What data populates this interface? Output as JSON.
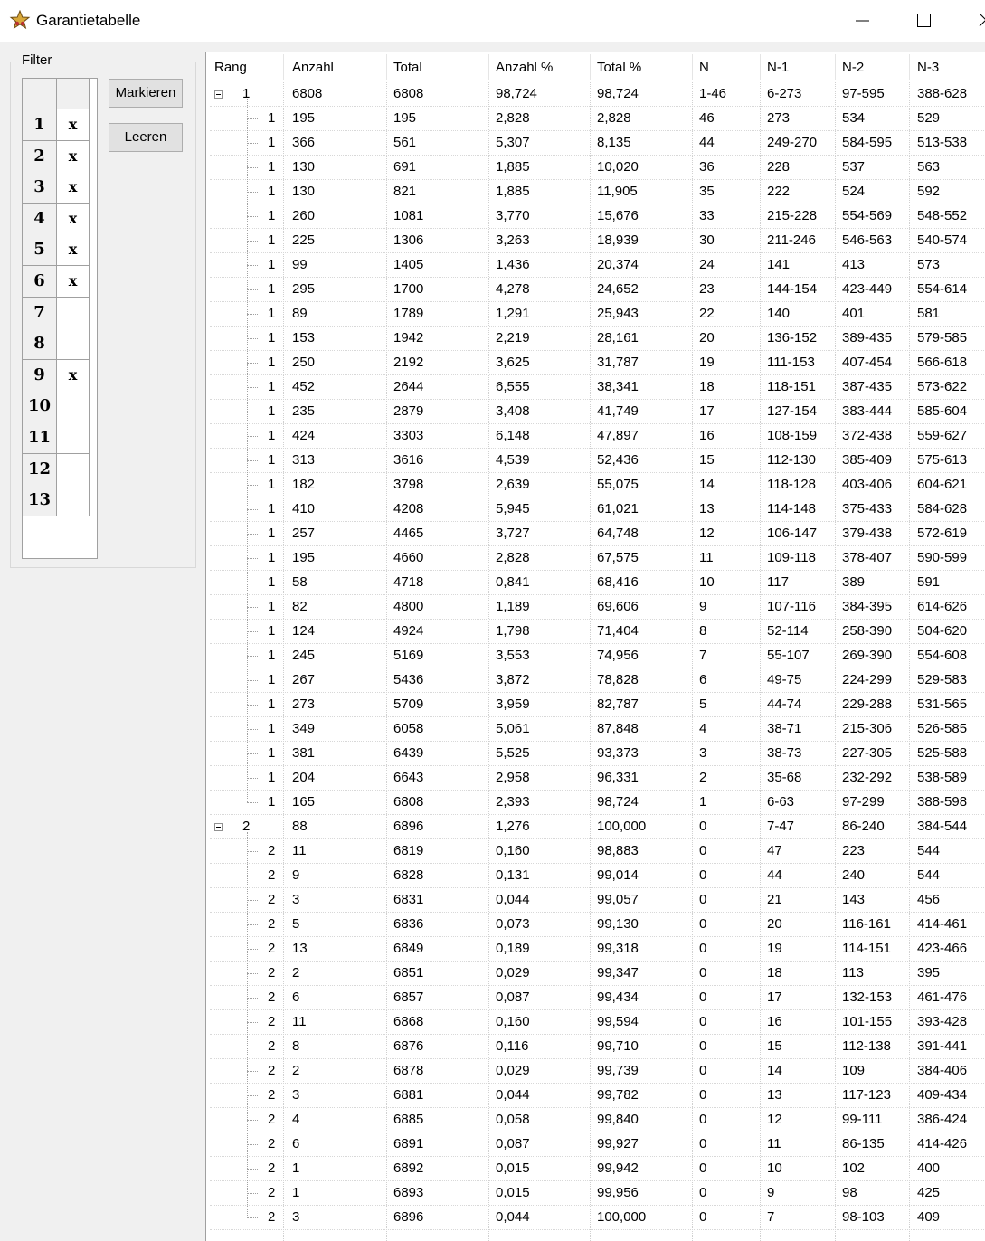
{
  "window": {
    "title": "Garantietabelle"
  },
  "filter": {
    "label": "Filter",
    "rows": [
      {
        "num": "1",
        "val": "x"
      },
      {
        "num": "2",
        "val": "x"
      },
      {
        "num": "3",
        "val": "x"
      },
      {
        "num": "4",
        "val": "x"
      },
      {
        "num": "5",
        "val": "x"
      },
      {
        "num": "6",
        "val": "x"
      },
      {
        "num": "7",
        "val": ""
      },
      {
        "num": "8",
        "val": ""
      },
      {
        "num": "9",
        "val": "x"
      },
      {
        "num": "10",
        "val": ""
      },
      {
        "num": "11",
        "val": ""
      },
      {
        "num": "12",
        "val": ""
      },
      {
        "num": "13",
        "val": ""
      }
    ],
    "mark_button": "Markieren",
    "clear_button": "Leeren"
  },
  "table": {
    "columns": [
      "Rang",
      "Anzahl",
      "Total",
      "Anzahl %",
      "Total %",
      "N",
      "N-1",
      "N-2",
      "N-3"
    ],
    "rows": [
      {
        "level": 0,
        "cells": [
          "1",
          "6808",
          "6808",
          "98,724",
          "98,724",
          "1-46",
          "6-273",
          "97-595",
          "388-628"
        ]
      },
      {
        "level": 1,
        "cells": [
          "1",
          "195",
          "195",
          "2,828",
          "2,828",
          "46",
          "273",
          "534",
          "529"
        ]
      },
      {
        "level": 1,
        "cells": [
          "1",
          "366",
          "561",
          "5,307",
          "8,135",
          "44",
          "249-270",
          "584-595",
          "513-538"
        ]
      },
      {
        "level": 1,
        "cells": [
          "1",
          "130",
          "691",
          "1,885",
          "10,020",
          "36",
          "228",
          "537",
          "563"
        ]
      },
      {
        "level": 1,
        "cells": [
          "1",
          "130",
          "821",
          "1,885",
          "11,905",
          "35",
          "222",
          "524",
          "592"
        ]
      },
      {
        "level": 1,
        "cells": [
          "1",
          "260",
          "1081",
          "3,770",
          "15,676",
          "33",
          "215-228",
          "554-569",
          "548-552"
        ]
      },
      {
        "level": 1,
        "cells": [
          "1",
          "225",
          "1306",
          "3,263",
          "18,939",
          "30",
          "211-246",
          "546-563",
          "540-574"
        ]
      },
      {
        "level": 1,
        "cells": [
          "1",
          "99",
          "1405",
          "1,436",
          "20,374",
          "24",
          "141",
          "413",
          "573"
        ]
      },
      {
        "level": 1,
        "cells": [
          "1",
          "295",
          "1700",
          "4,278",
          "24,652",
          "23",
          "144-154",
          "423-449",
          "554-614"
        ]
      },
      {
        "level": 1,
        "cells": [
          "1",
          "89",
          "1789",
          "1,291",
          "25,943",
          "22",
          "140",
          "401",
          "581"
        ]
      },
      {
        "level": 1,
        "cells": [
          "1",
          "153",
          "1942",
          "2,219",
          "28,161",
          "20",
          "136-152",
          "389-435",
          "579-585"
        ]
      },
      {
        "level": 1,
        "cells": [
          "1",
          "250",
          "2192",
          "3,625",
          "31,787",
          "19",
          "111-153",
          "407-454",
          "566-618"
        ]
      },
      {
        "level": 1,
        "cells": [
          "1",
          "452",
          "2644",
          "6,555",
          "38,341",
          "18",
          "118-151",
          "387-435",
          "573-622"
        ]
      },
      {
        "level": 1,
        "cells": [
          "1",
          "235",
          "2879",
          "3,408",
          "41,749",
          "17",
          "127-154",
          "383-444",
          "585-604"
        ]
      },
      {
        "level": 1,
        "cells": [
          "1",
          "424",
          "3303",
          "6,148",
          "47,897",
          "16",
          "108-159",
          "372-438",
          "559-627"
        ]
      },
      {
        "level": 1,
        "cells": [
          "1",
          "313",
          "3616",
          "4,539",
          "52,436",
          "15",
          "112-130",
          "385-409",
          "575-613"
        ]
      },
      {
        "level": 1,
        "cells": [
          "1",
          "182",
          "3798",
          "2,639",
          "55,075",
          "14",
          "118-128",
          "403-406",
          "604-621"
        ]
      },
      {
        "level": 1,
        "cells": [
          "1",
          "410",
          "4208",
          "5,945",
          "61,021",
          "13",
          "114-148",
          "375-433",
          "584-628"
        ]
      },
      {
        "level": 1,
        "cells": [
          "1",
          "257",
          "4465",
          "3,727",
          "64,748",
          "12",
          "106-147",
          "379-438",
          "572-619"
        ]
      },
      {
        "level": 1,
        "cells": [
          "1",
          "195",
          "4660",
          "2,828",
          "67,575",
          "11",
          "109-118",
          "378-407",
          "590-599"
        ]
      },
      {
        "level": 1,
        "cells": [
          "1",
          "58",
          "4718",
          "0,841",
          "68,416",
          "10",
          "117",
          "389",
          "591"
        ]
      },
      {
        "level": 1,
        "cells": [
          "1",
          "82",
          "4800",
          "1,189",
          "69,606",
          "9",
          "107-116",
          "384-395",
          "614-626"
        ]
      },
      {
        "level": 1,
        "cells": [
          "1",
          "124",
          "4924",
          "1,798",
          "71,404",
          "8",
          "52-114",
          "258-390",
          "504-620"
        ]
      },
      {
        "level": 1,
        "cells": [
          "1",
          "245",
          "5169",
          "3,553",
          "74,956",
          "7",
          "55-107",
          "269-390",
          "554-608"
        ]
      },
      {
        "level": 1,
        "cells": [
          "1",
          "267",
          "5436",
          "3,872",
          "78,828",
          "6",
          "49-75",
          "224-299",
          "529-583"
        ]
      },
      {
        "level": 1,
        "cells": [
          "1",
          "273",
          "5709",
          "3,959",
          "82,787",
          "5",
          "44-74",
          "229-288",
          "531-565"
        ]
      },
      {
        "level": 1,
        "cells": [
          "1",
          "349",
          "6058",
          "5,061",
          "87,848",
          "4",
          "38-71",
          "215-306",
          "526-585"
        ]
      },
      {
        "level": 1,
        "cells": [
          "1",
          "381",
          "6439",
          "5,525",
          "93,373",
          "3",
          "38-73",
          "227-305",
          "525-588"
        ]
      },
      {
        "level": 1,
        "cells": [
          "1",
          "204",
          "6643",
          "2,958",
          "96,331",
          "2",
          "35-68",
          "232-292",
          "538-589"
        ]
      },
      {
        "level": 1,
        "cells": [
          "1",
          "165",
          "6808",
          "2,393",
          "98,724",
          "1",
          "6-63",
          "97-299",
          "388-598"
        ]
      },
      {
        "level": 0,
        "cells": [
          "2",
          "88",
          "6896",
          "1,276",
          "100,000",
          "0",
          "7-47",
          "86-240",
          "384-544"
        ]
      },
      {
        "level": 1,
        "cells": [
          "2",
          "11",
          "6819",
          "0,160",
          "98,883",
          "0",
          "47",
          "223",
          "544"
        ]
      },
      {
        "level": 1,
        "cells": [
          "2",
          "9",
          "6828",
          "0,131",
          "99,014",
          "0",
          "44",
          "240",
          "544"
        ]
      },
      {
        "level": 1,
        "cells": [
          "2",
          "3",
          "6831",
          "0,044",
          "99,057",
          "0",
          "21",
          "143",
          "456"
        ]
      },
      {
        "level": 1,
        "cells": [
          "2",
          "5",
          "6836",
          "0,073",
          "99,130",
          "0",
          "20",
          "116-161",
          "414-461"
        ]
      },
      {
        "level": 1,
        "cells": [
          "2",
          "13",
          "6849",
          "0,189",
          "99,318",
          "0",
          "19",
          "114-151",
          "423-466"
        ]
      },
      {
        "level": 1,
        "cells": [
          "2",
          "2",
          "6851",
          "0,029",
          "99,347",
          "0",
          "18",
          "113",
          "395"
        ]
      },
      {
        "level": 1,
        "cells": [
          "2",
          "6",
          "6857",
          "0,087",
          "99,434",
          "0",
          "17",
          "132-153",
          "461-476"
        ]
      },
      {
        "level": 1,
        "cells": [
          "2",
          "11",
          "6868",
          "0,160",
          "99,594",
          "0",
          "16",
          "101-155",
          "393-428"
        ]
      },
      {
        "level": 1,
        "cells": [
          "2",
          "8",
          "6876",
          "0,116",
          "99,710",
          "0",
          "15",
          "112-138",
          "391-441"
        ]
      },
      {
        "level": 1,
        "cells": [
          "2",
          "2",
          "6878",
          "0,029",
          "99,739",
          "0",
          "14",
          "109",
          "384-406"
        ]
      },
      {
        "level": 1,
        "cells": [
          "2",
          "3",
          "6881",
          "0,044",
          "99,782",
          "0",
          "13",
          "117-123",
          "409-434"
        ]
      },
      {
        "level": 1,
        "cells": [
          "2",
          "4",
          "6885",
          "0,058",
          "99,840",
          "0",
          "12",
          "99-111",
          "386-424"
        ]
      },
      {
        "level": 1,
        "cells": [
          "2",
          "6",
          "6891",
          "0,087",
          "99,927",
          "0",
          "11",
          "86-135",
          "414-426"
        ]
      },
      {
        "level": 1,
        "cells": [
          "2",
          "1",
          "6892",
          "0,015",
          "99,942",
          "0",
          "10",
          "102",
          "400"
        ]
      },
      {
        "level": 1,
        "cells": [
          "2",
          "1",
          "6893",
          "0,015",
          "99,956",
          "0",
          "9",
          "98",
          "425"
        ]
      },
      {
        "level": 1,
        "cells": [
          "2",
          "3",
          "6896",
          "0,044",
          "100,000",
          "0",
          "7",
          "98-103",
          "409"
        ]
      }
    ]
  }
}
